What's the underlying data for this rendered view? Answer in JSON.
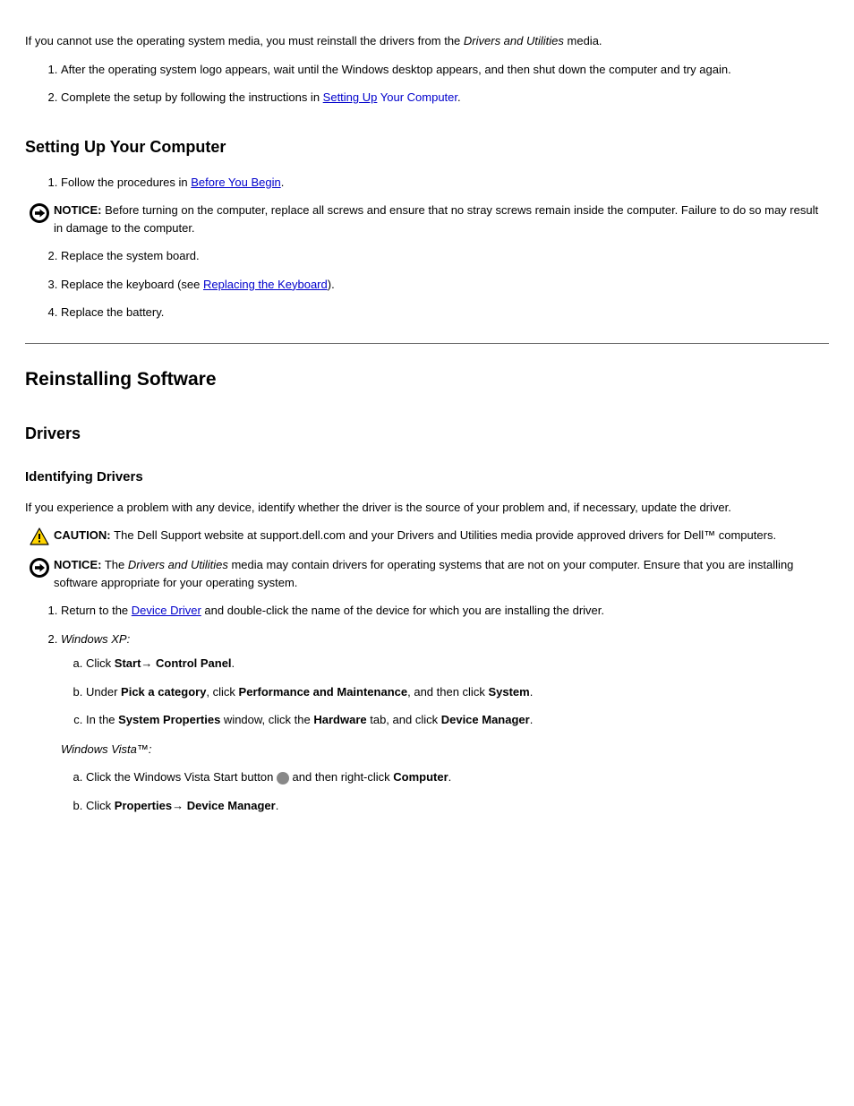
{
  "intro": {
    "para1_pre": "If you cannot use the operating system media, you must reinstall the drivers from the ",
    "para1_em": "Drivers and Utilities",
    "para1_post": " media.",
    "step1_pre": "After the operating system logo appears, wait until the ",
    "step1_os": "Windows",
    "step1_post": " desktop appears, and then shut down the computer and try again.",
    "step2_pre": "Complete the setup by following the instructions in ",
    "step2_link": "Setting Up",
    "step2_link_post": " Your Computer",
    "step2_post": "."
  },
  "setup": {
    "heading": "Setting Up Your Computer",
    "step1_pre": "Follow the procedures in ",
    "step1_link": "Before You Begin",
    "step1_post": "."
  },
  "notice1": {
    "label": "NOTICE:",
    "text": " Before turning on the computer, replace all screws and ensure that no stray screws remain inside the computer. Failure to do so may result in damage to the computer."
  },
  "replace": {
    "step1": "Replace the system board.",
    "step2_pre": "Replace the keyboard (see ",
    "step2_link": "Replacing the Keyboard",
    "step2_post": ").",
    "step3": "Replace the battery."
  },
  "reinstall": {
    "heading": "Reinstalling Software",
    "subheading": "Drivers",
    "subsub": "Identifying Drivers",
    "intro": "If you experience a problem with any device, identify whether the driver is the source of your problem and, if necessary, update the driver."
  },
  "caution": {
    "label": "CAUTION: ",
    "text": "The Dell Support website at support.dell.com and your Drivers and Utilities media provide approved drivers for Dell™ computers."
  },
  "notice2": {
    "label": "NOTICE:",
    "pre": " The ",
    "em": "Drivers and Utilities",
    "post": " media may contain drivers for operating systems that are not on your computer. Ensure that you are installing software appropriate for your operating system."
  },
  "xp": {
    "step1_pre": "Return to the ",
    "step1_link": "Device Driver",
    "step1_post": " and double-click the name of the device for which you are installing the driver.",
    "step2_label": "Windows XP:",
    "step2a_pre": "Click ",
    "step2a_b1": "Start",
    "step2a_arrow": "→ ",
    "step2a_b2": "Control Panel",
    "step2a_post": ".",
    "step2b_pre": "Under ",
    "step2b_b1": "Pick a category",
    "step2b_mid": ", click ",
    "step2b_b2": "Performance and Maintenance",
    "step2b_mid2": ", and then click ",
    "step2b_b3": "System",
    "step2b_post": ".",
    "step2c_pre": "In the ",
    "step2c_b1": "System Properties",
    "step2c_mid": " window, click the ",
    "step2c_b2": "Hardware",
    "step2c_mid2": " tab, and click ",
    "step2c_b3": "Device Manager",
    "step2c_post": "."
  },
  "vista": {
    "label": "Windows Vista™:",
    "step_a_pre": "Click the Windows Vista Start button ",
    "step_a_mid": " and then right-click ",
    "step_a_b1": "Computer",
    "step_a_post": ".",
    "step_b_pre": "Click ",
    "step_b_b1": "Properties",
    "step_b_arrow": "→ ",
    "step_b_b2": "Device Manager",
    "step_b_post": "."
  }
}
